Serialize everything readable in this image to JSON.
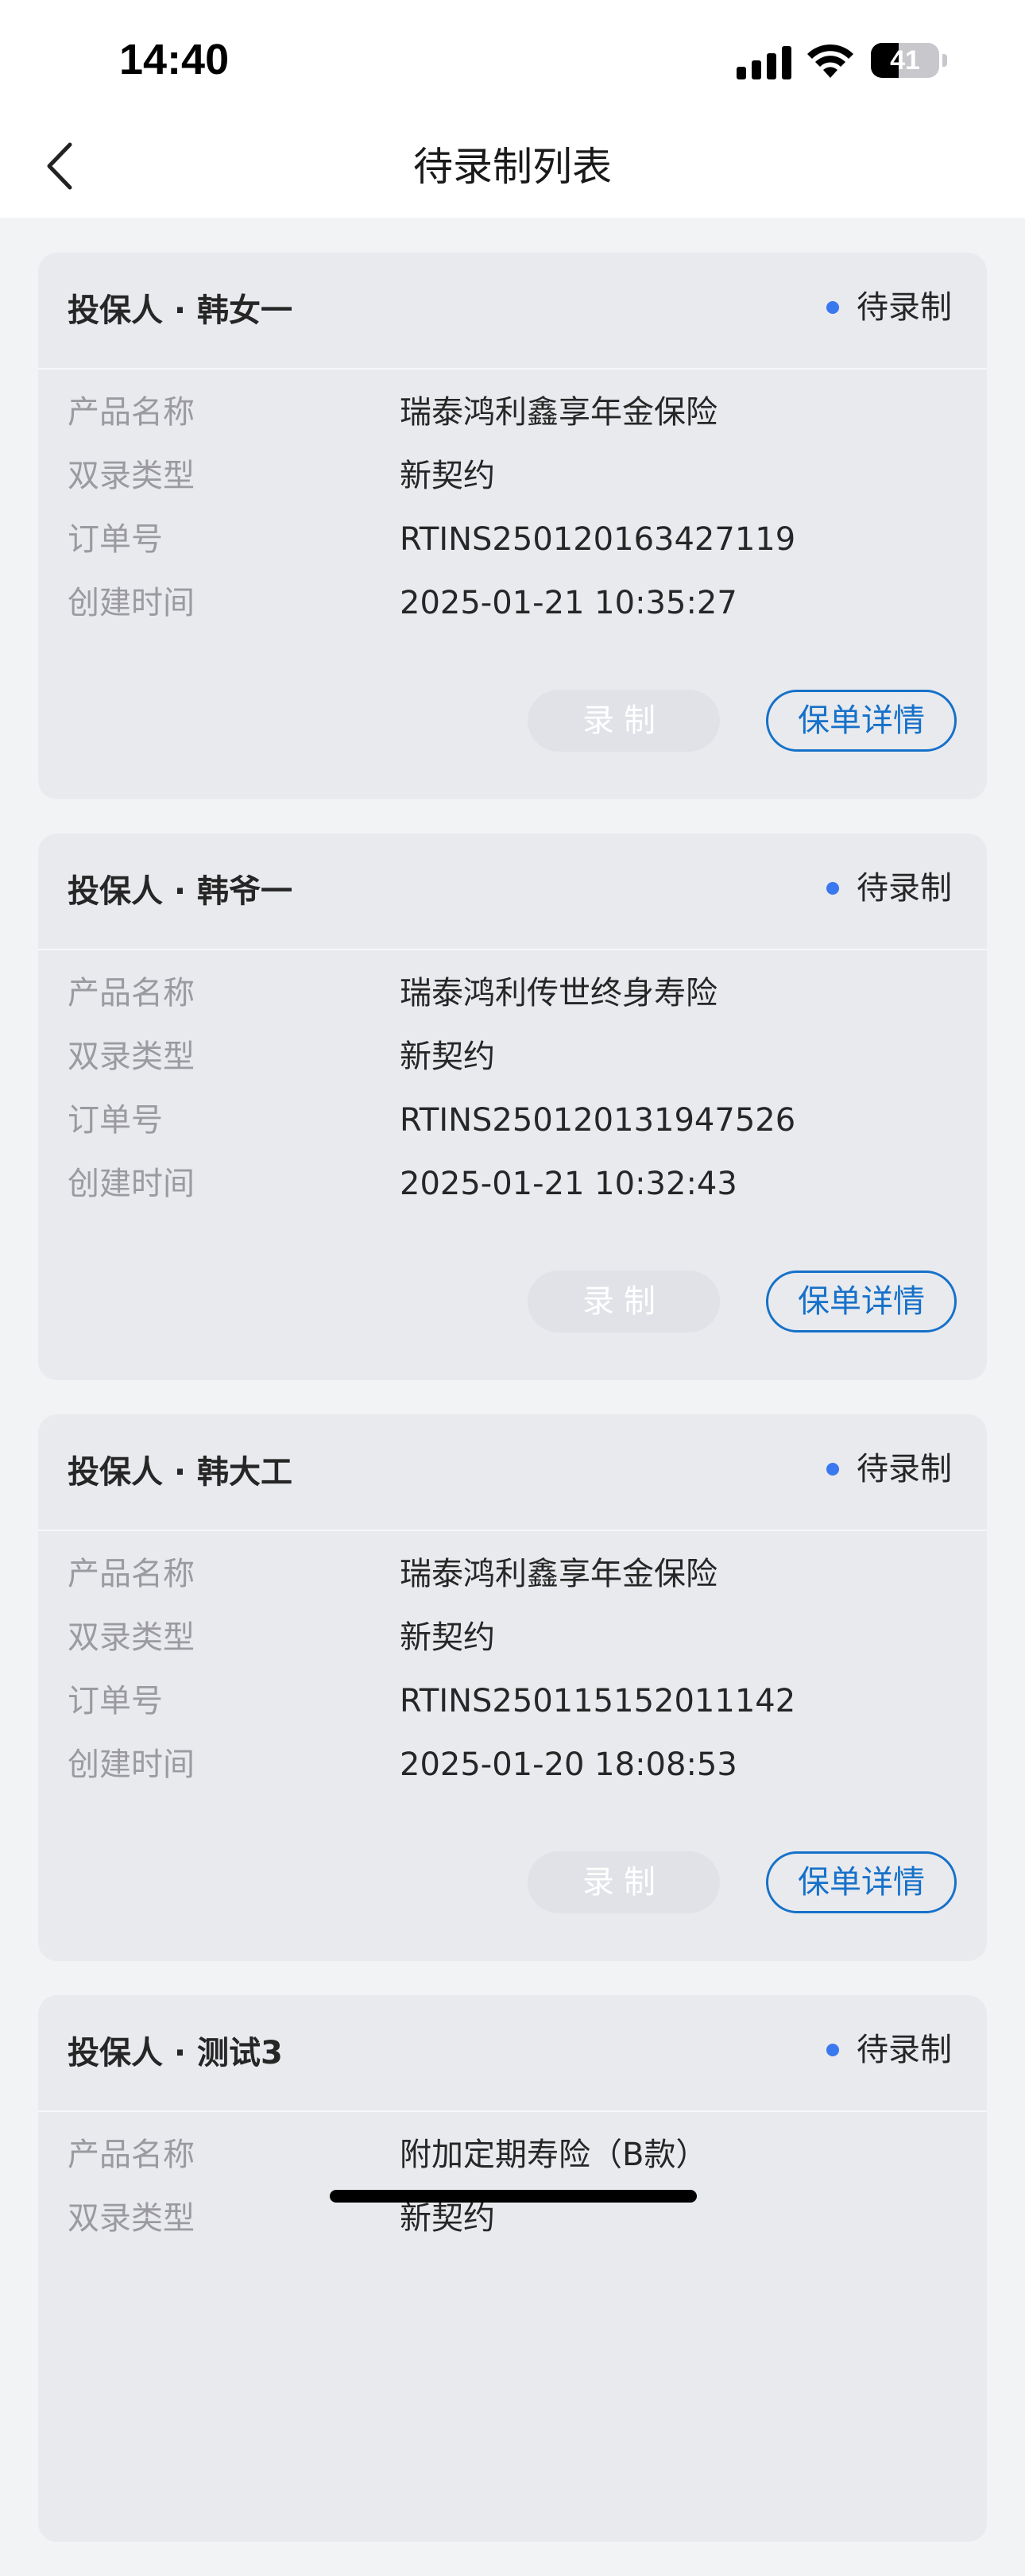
{
  "status_bar": {
    "time": "14:40",
    "battery_percent": "41",
    "battery_level": 0.41
  },
  "nav": {
    "title": "待录制列表"
  },
  "labels": {
    "product": "产品名称",
    "type": "双录类型",
    "order": "订单号",
    "created": "创建时间",
    "record_button": "录制",
    "detail_button": "保单详情"
  },
  "cards": [
    {
      "insured": "投保人 · 韩女一",
      "status": "待录制",
      "product": "瑞泰鸿利鑫享年金保险",
      "type": "新契约",
      "order": "RTINS250120163427119",
      "created": "2025-01-21 10:35:27"
    },
    {
      "insured": "投保人 · 韩爷一",
      "status": "待录制",
      "product": "瑞泰鸿利传世终身寿险",
      "type": "新契约",
      "order": "RTINS250120131947526",
      "created": "2025-01-21 10:32:43"
    },
    {
      "insured": "投保人 · 韩大工",
      "status": "待录制",
      "product": "瑞泰鸿利鑫享年金保险",
      "type": "新契约",
      "order": "RTINS250115152011142",
      "created": "2025-01-20 18:08:53"
    },
    {
      "insured": "投保人 · 测试3",
      "status": "待录制",
      "product": "附加定期寿险（B款）",
      "type": "新契约",
      "order": "",
      "created": ""
    }
  ],
  "colors": {
    "accent": "#1671c9",
    "status_dot": "#3a78f0"
  }
}
